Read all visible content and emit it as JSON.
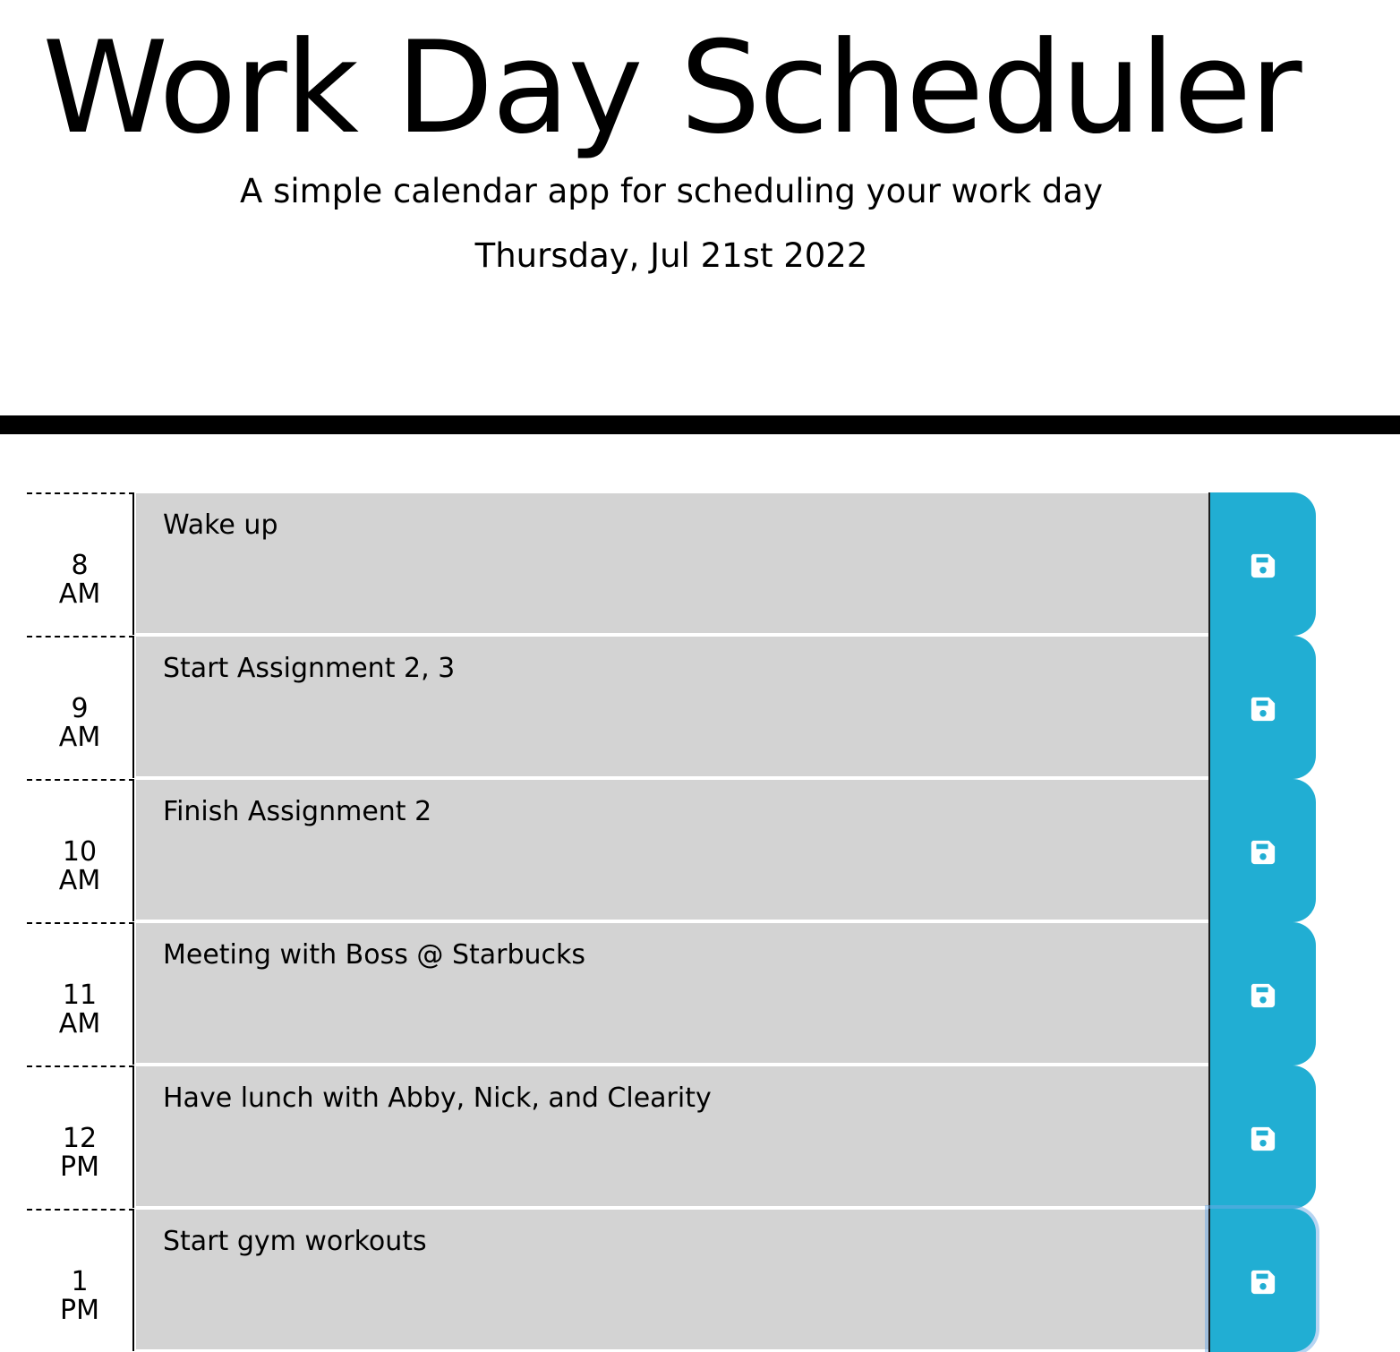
{
  "header": {
    "title": "Work Day Scheduler",
    "subtitle": "A simple calendar app for scheduling your work day",
    "current_date": "Thursday, Jul 21st 2022"
  },
  "colors": {
    "save_button": "#21aed3",
    "task_past": "#d3d3d3",
    "divider": "#000000"
  },
  "save_icon": "floppy-disk-icon",
  "rows": [
    {
      "hour": "8",
      "period": "AM",
      "task": "Wake up"
    },
    {
      "hour": "9",
      "period": "AM",
      "task": "Start Assignment 2, 3"
    },
    {
      "hour": "10",
      "period": "AM",
      "task": "Finish Assignment 2"
    },
    {
      "hour": "11",
      "period": "AM",
      "task": "Meeting with Boss @ Starbucks"
    },
    {
      "hour": "12",
      "period": "PM",
      "task": "Have lunch with Abby, Nick, and Clearity"
    },
    {
      "hour": "1",
      "period": "PM",
      "task": "Start gym workouts"
    }
  ]
}
